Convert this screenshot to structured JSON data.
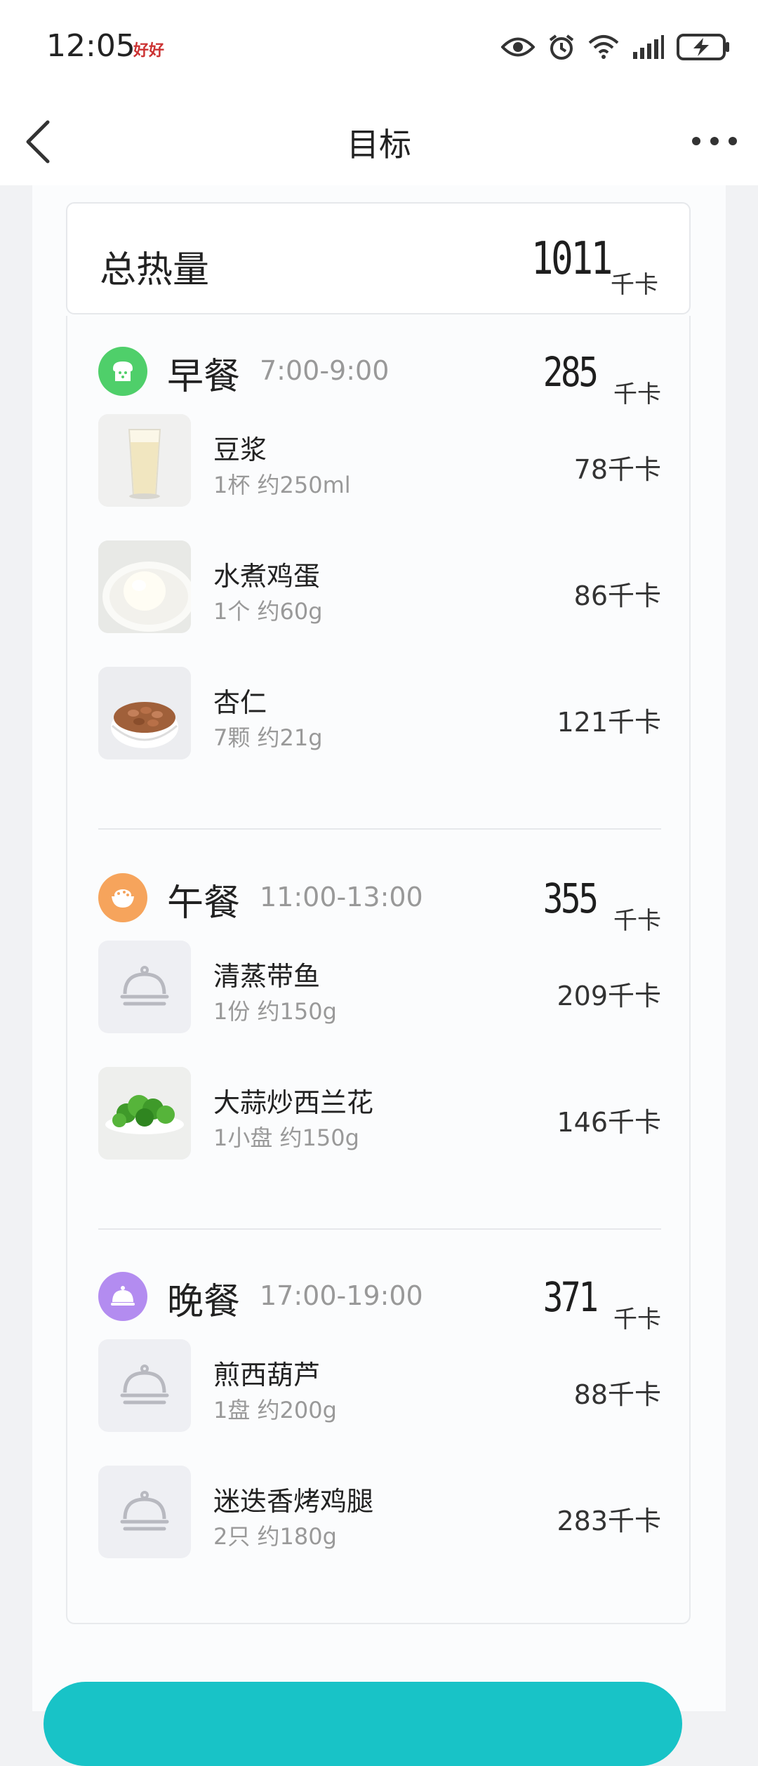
{
  "status": {
    "time": "12:05",
    "badge": "好好"
  },
  "header": {
    "title": "目标"
  },
  "total": {
    "label": "总热量",
    "value": "1011",
    "unit": "千卡"
  },
  "meals": [
    {
      "name": "早餐",
      "time": "7:00-9:00",
      "kcal": "285",
      "unit": "千卡",
      "icon": "bread-icon",
      "color": "#4fcf6a",
      "items": [
        {
          "name": "豆浆",
          "portion": "1杯  约250ml",
          "kcal": "78千卡",
          "thumb": "soy-milk"
        },
        {
          "name": "水煮鸡蛋",
          "portion": "1个  约60g",
          "kcal": "86千卡",
          "thumb": "boiled-egg"
        },
        {
          "name": "杏仁",
          "portion": "7颗  约21g",
          "kcal": "121千卡",
          "thumb": "almonds"
        }
      ]
    },
    {
      "name": "午餐",
      "time": "11:00-13:00",
      "kcal": "355",
      "unit": "千卡",
      "icon": "rice-bowl-icon",
      "color": "#f6a45c",
      "items": [
        {
          "name": "清蒸带鱼",
          "portion": "1份  约150g",
          "kcal": "209千卡",
          "thumb": "cloche"
        },
        {
          "name": "大蒜炒西兰花",
          "portion": "1小盘  约150g",
          "kcal": "146千卡",
          "thumb": "broccoli"
        }
      ]
    },
    {
      "name": "晚餐",
      "time": "17:00-19:00",
      "kcal": "371",
      "unit": "千卡",
      "icon": "cloche-icon",
      "color": "#b38cf0",
      "items": [
        {
          "name": "煎西葫芦",
          "portion": "1盘  约200g",
          "kcal": "88千卡",
          "thumb": "cloche"
        },
        {
          "name": "迷迭香烤鸡腿",
          "portion": "2只  约180g",
          "kcal": "283千卡",
          "thumb": "cloche"
        }
      ]
    }
  ]
}
